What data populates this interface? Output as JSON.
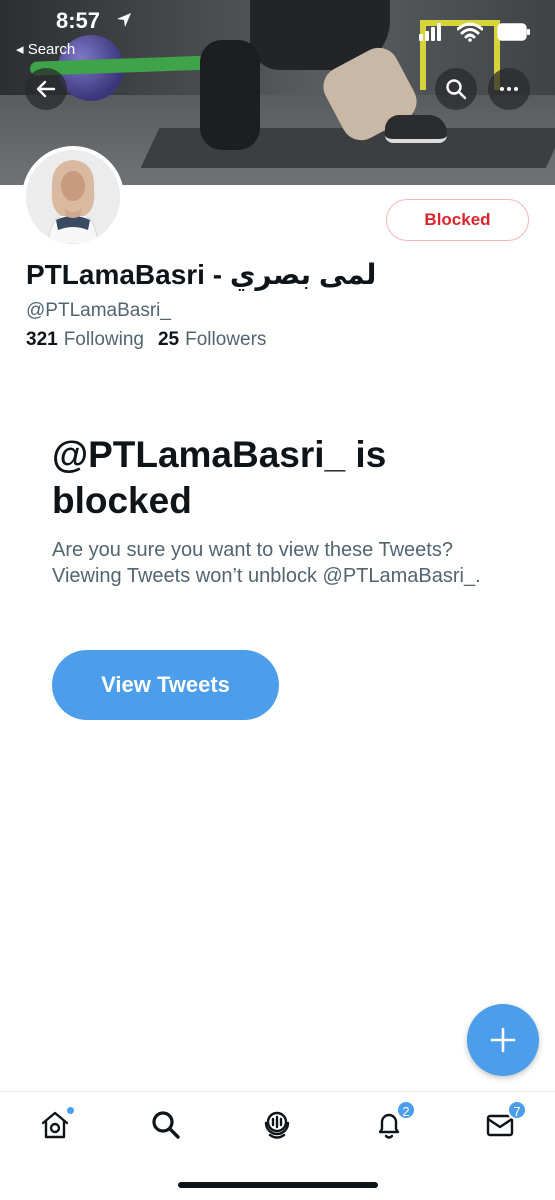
{
  "status_bar": {
    "time": "8:57",
    "back_label": "◂ Search"
  },
  "profile": {
    "display_name": "PTLamaBasri - لمى بصري",
    "handle": "@PTLamaBasri_",
    "following_count": "321",
    "following_label": "Following",
    "followers_count": "25",
    "followers_label": "Followers",
    "blocked_button_label": "Blocked"
  },
  "blocked_notice": {
    "title": "@PTLamaBasri_ is blocked",
    "description": "Are you sure you want to view these Tweets? Viewing Tweets won’t unblock @PTLamaBasri_.",
    "view_button_label": "View Tweets"
  },
  "tabs": [
    {
      "icon": "home-icon",
      "has_dot": true
    },
    {
      "icon": "search-icon"
    },
    {
      "icon": "spaces-icon"
    },
    {
      "icon": "bell-icon",
      "badge": "2"
    },
    {
      "icon": "mail-icon",
      "badge": "7"
    }
  ],
  "colors": {
    "accent": "#4c9eeb",
    "blocked_red": "#d9262e",
    "secondary_text": "#536471"
  }
}
